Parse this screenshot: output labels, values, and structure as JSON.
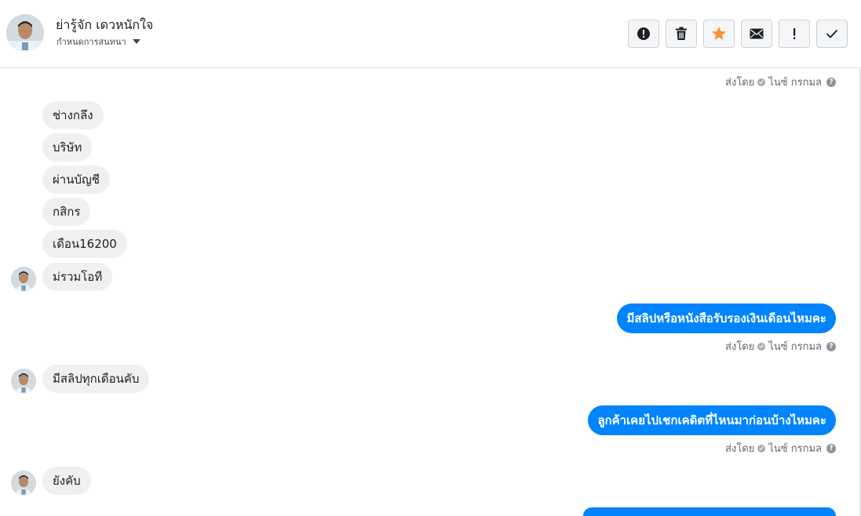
{
  "header": {
    "contact_name": "ย่ารู้จัก เดวหนักใจ",
    "assign_label": "กำหนดการสนทนา",
    "tools": [
      {
        "name": "report-spam-button",
        "icon": "alert-circle-icon"
      },
      {
        "name": "delete-button",
        "icon": "trash-icon"
      },
      {
        "name": "star-button",
        "icon": "star-icon"
      },
      {
        "name": "mark-unread-button",
        "icon": "envelope-icon"
      },
      {
        "name": "mark-important-button",
        "icon": "exclamation-icon"
      },
      {
        "name": "mark-done-button",
        "icon": "checkmark-icon"
      }
    ]
  },
  "sent_meta": {
    "prefix": "ส่งโดย",
    "sender": "ไนซ์ กรกมล",
    "help": "?"
  },
  "thread": {
    "incoming_group_1": [
      "ช่างกลึง",
      "บริษัท",
      "ผ่านบัญชี",
      "กสิกร",
      "เดือน16200",
      "ม่รวมโอที"
    ],
    "outgoing_1": "มีสลิปหรือหนังสือรับรองเงินเดือนไหมคะ",
    "incoming_2": "มีสลิปทุกเดือนคับ",
    "outgoing_2": "ลูกค้าเคยไปเชกเคดิตที่ไหนมาก่อนบ้างไหมคะ",
    "incoming_3": "ยังคับ"
  },
  "colors": {
    "accent": "#0084ff",
    "incoming_bubble": "#f1f0f0",
    "star": "#f7923a"
  }
}
